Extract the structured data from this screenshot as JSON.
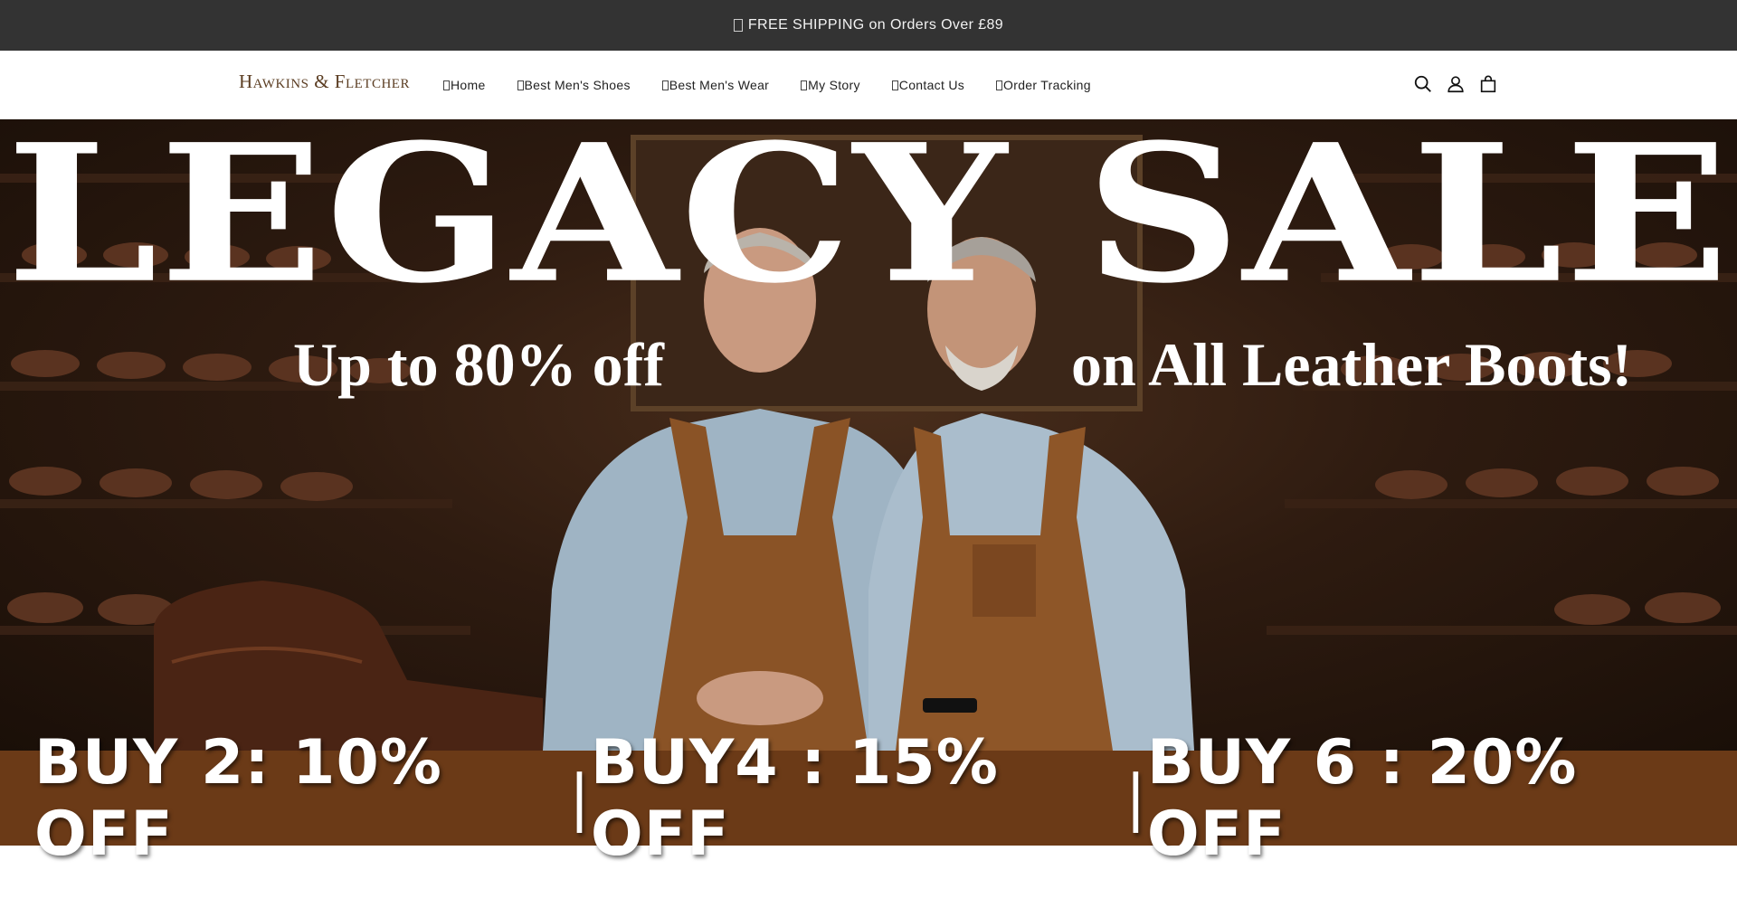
{
  "announcement": {
    "text": "FREE SHIPPING on Orders Over £89"
  },
  "header": {
    "logo": "Hawkins & Fletcher",
    "nav": [
      {
        "label": "Home"
      },
      {
        "label": "Best Men's Shoes"
      },
      {
        "label": "Best Men's Wear"
      },
      {
        "label": "My Story"
      },
      {
        "label": "Contact Us"
      },
      {
        "label": "Order Tracking"
      }
    ],
    "icons": [
      "search-icon",
      "account-icon",
      "cart-icon"
    ]
  },
  "hero": {
    "title": "LEGACY SALE",
    "subtitle_left": "Up to 80% off",
    "subtitle_right": "on All Leather Boots!"
  },
  "offers": {
    "items": [
      "BUY 2: 10% OFF",
      "BUY4 : 15% OFF",
      "BUY 6 : 20% OFF"
    ],
    "separator": "|"
  },
  "colors": {
    "announce_bg": "#333333",
    "offer_bg": "#6b3a17",
    "logo": "#5b3d22",
    "hero_text": "#ffffff"
  }
}
